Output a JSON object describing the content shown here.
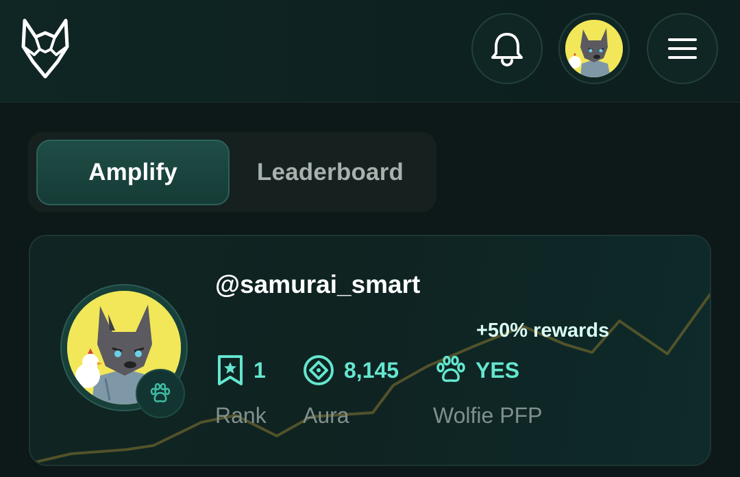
{
  "header": {
    "logo_icon": "wolf-head-icon",
    "notification_icon": "bell-icon",
    "profile_icon": "avatar",
    "menu_icon": "hamburger-menu-icon"
  },
  "tabs": [
    {
      "label": "Amplify",
      "active": true
    },
    {
      "label": "Leaderboard",
      "active": false
    }
  ],
  "profile": {
    "username": "@samurai_smart",
    "rewards_note": "+50% rewards",
    "stats": {
      "rank": {
        "value": "1",
        "label": "Rank",
        "icon": "bookmark-star-icon"
      },
      "aura": {
        "value": "8,145",
        "label": "Aura",
        "icon": "diamond-circle-icon"
      },
      "pfp": {
        "value": "YES",
        "label": "Wolfie PFP",
        "icon": "paw-icon"
      }
    }
  },
  "colors": {
    "accent": "#64e6cf",
    "background": "#0c1918",
    "trend_line": "#5e5a2c",
    "avatar_bg": "#f2e758"
  }
}
